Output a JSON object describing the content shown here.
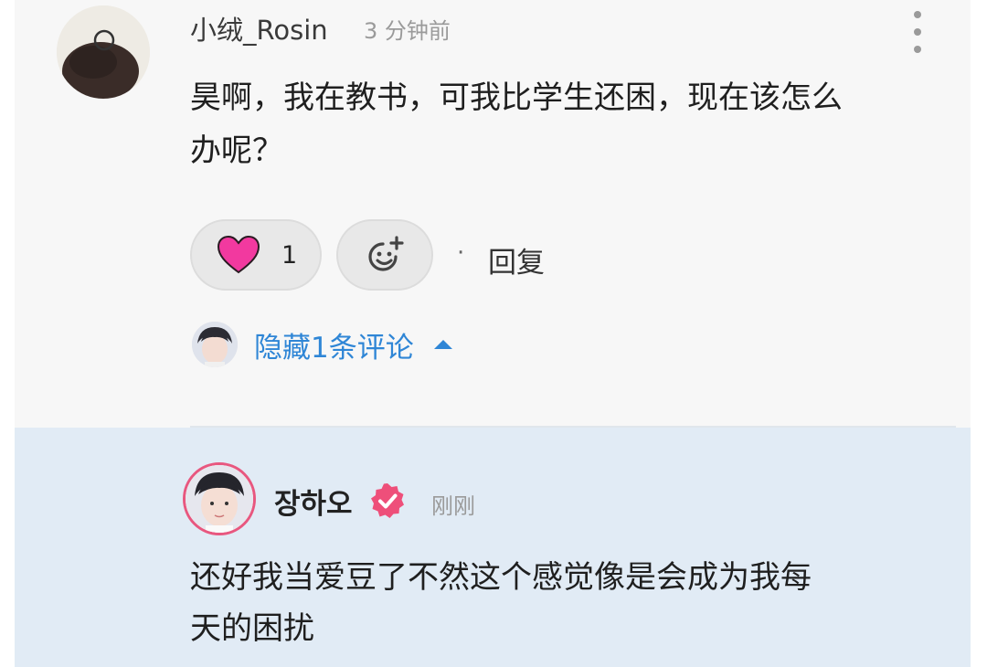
{
  "comment": {
    "username": "小绒_Rosin",
    "time": "3 分钟前",
    "text_line1": "昊啊，我在教书，可我比学生还困，现在该怎么",
    "text_line2": "办呢？",
    "likes": "1",
    "dot": "·",
    "reply_label": "回复",
    "hidden_replies_label": "隐藏1条评论"
  },
  "reply": {
    "username": "장하오",
    "time": "刚刚",
    "text_line1": "还好我当爱豆了不然这个感觉像是会成为我每",
    "text_line2": "天的困扰"
  },
  "icons": {
    "more": "more-vertical-icon",
    "like": "heart-icon",
    "emoji": "add-emoji-icon",
    "expand": "caret-up-icon",
    "verified": "verified-badge-icon"
  },
  "colors": {
    "heart": "#f2399f",
    "link_blue": "#2f86d6",
    "verified_pink": "#ee4f7a",
    "reply_background": "#e1ebf5"
  }
}
